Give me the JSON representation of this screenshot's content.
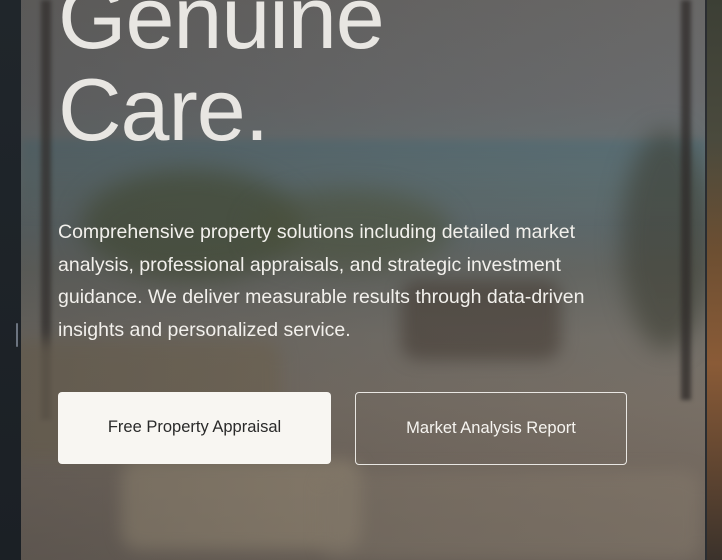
{
  "hero": {
    "headline_line1": "Genuine",
    "headline_line2": "Care.",
    "description": "Comprehensive property solutions including detailed market analysis, professional appraisals, and strategic investment guidance. We deliver measurable results through data-driven insights and personalized service.",
    "primary_button_label": "Free Property Appraisal",
    "secondary_button_label": "Market Analysis Report"
  },
  "colors": {
    "headline": "#e8e6e2",
    "body_text": "#f2f0ec",
    "primary_button_bg": "#f8f6f2",
    "primary_button_text": "#2a2a2a",
    "secondary_button_border": "#e9e7e3"
  }
}
